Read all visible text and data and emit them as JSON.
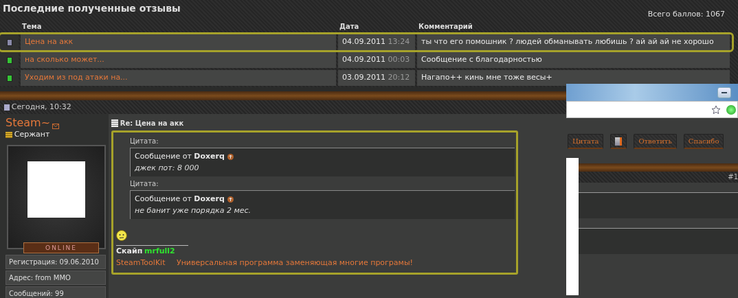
{
  "feedback": {
    "title": "Последние полученные отзывы",
    "total": "Всего баллов: 1067",
    "columns": [
      "Тема",
      "Дата",
      "Комментарий"
    ],
    "rows": [
      {
        "color": "#8a8aa8",
        "topic": "Цена на акк",
        "date": "04.09.2011",
        "time": "13:24",
        "comment": "ты что его помошник ? людей обманывать любишь ? ай ай ай не хорошо",
        "highlighted": true
      },
      {
        "color": "#35c435",
        "topic": "на сколько может...",
        "date": "04.09.2011",
        "time": "00:03",
        "comment": "Сообщение с благодарностью",
        "highlighted": false
      },
      {
        "color": "#35c435",
        "topic": "Уходим из под атаки на...",
        "date": "03.09.2011",
        "time": "20:12",
        "comment": "Нагапо++ кинь мне тоже весы+",
        "highlighted": false
      }
    ]
  },
  "post": {
    "date": "Сегодня, 10:32",
    "user": {
      "name": "Steam~",
      "rank": "Сержант",
      "status": "ONLINE",
      "info": [
        "Регистрация: 09.06.2010",
        "Адрес: from MMO",
        "Сообщений: 99"
      ]
    },
    "title": "Re: Цена на акк",
    "highlighted": true,
    "quotes": [
      {
        "label": "Цитата:",
        "author": "Сообщение от **Doxerq**",
        "text": "джек пот: 8 000"
      },
      {
        "label": "Цитата:",
        "author": "Сообщение от **Doxerq**",
        "text": "не банит уже порядка 2 мес."
      }
    ],
    "signature": {
      "label": "Скайп",
      "skype": "mrfull2",
      "link": "SteamToolKit",
      "slogan": "Универсальная программа заменяющая многие програмы!"
    }
  },
  "browser": {
    "buttons": [
      {
        "kind": "text",
        "label": "Цитата"
      },
      {
        "kind": "icon"
      },
      {
        "kind": "text",
        "label": "Ответить"
      },
      {
        "kind": "text",
        "label": "Спасибо"
      }
    ],
    "post_number": "#1"
  }
}
